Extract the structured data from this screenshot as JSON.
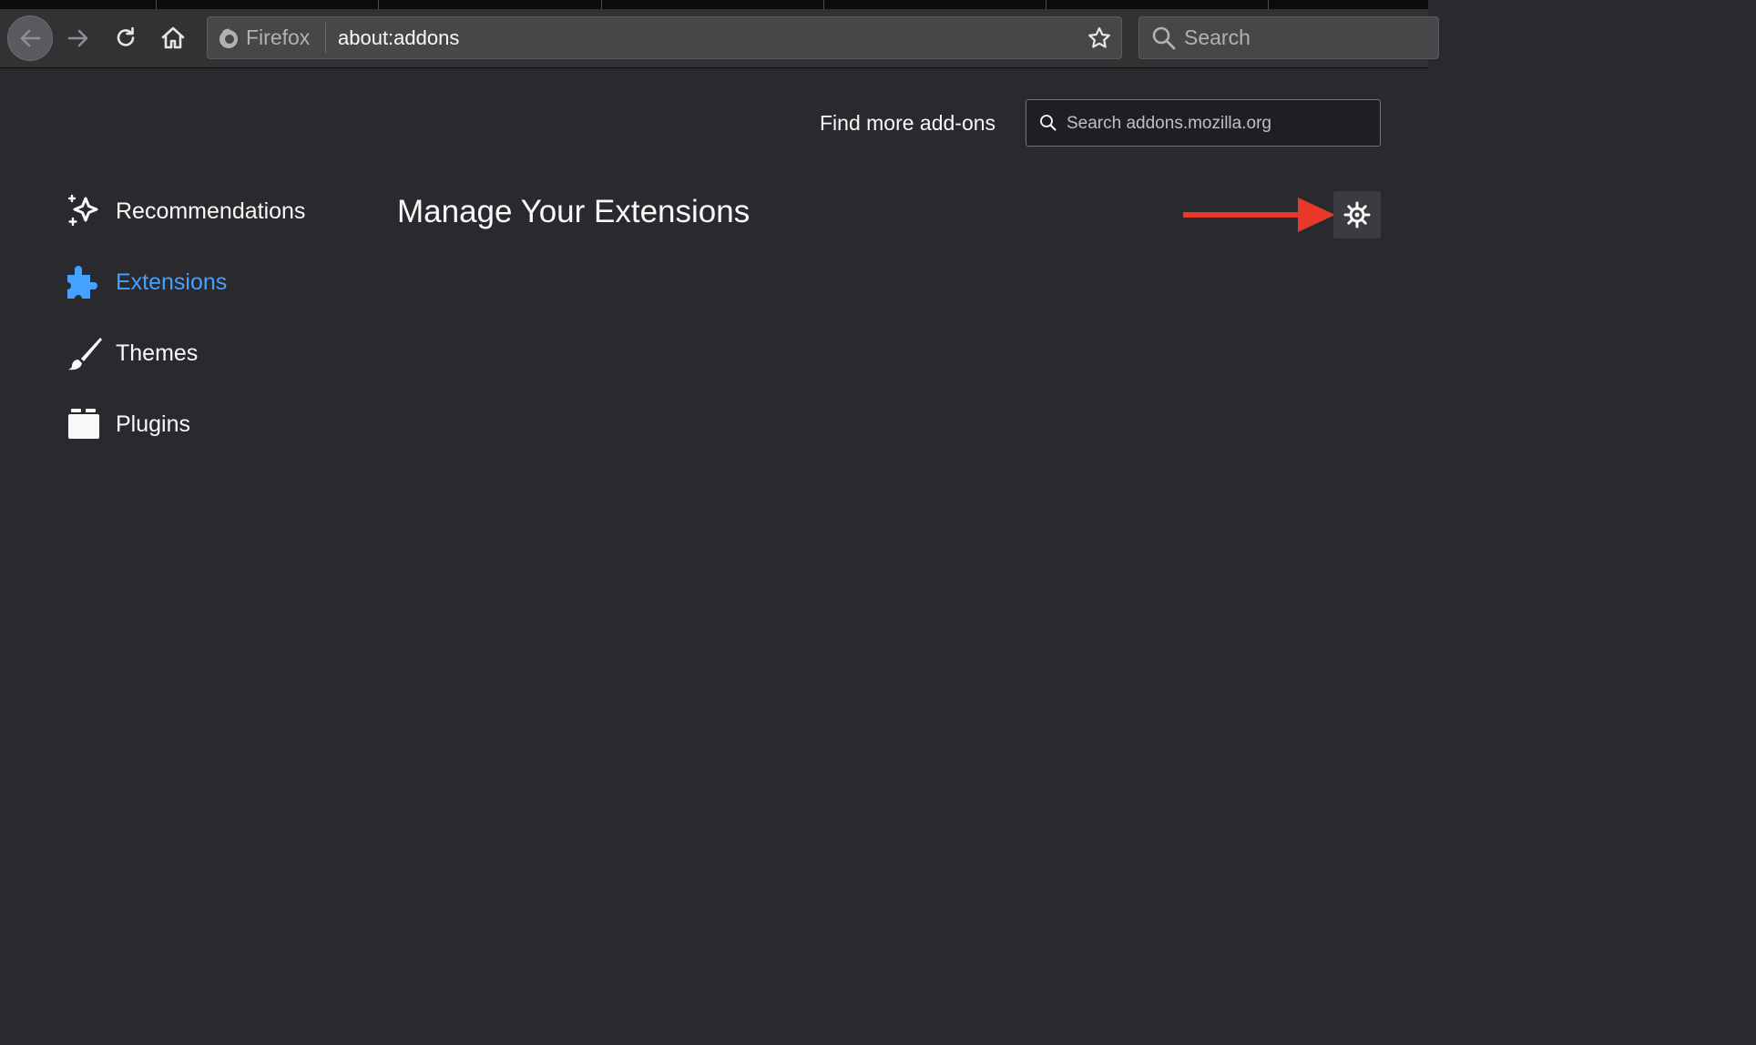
{
  "browser": {
    "identity_label": "Firefox",
    "url": "about:addons",
    "search_placeholder": "Search"
  },
  "header": {
    "find_more_label": "Find more add-ons",
    "amo_search_placeholder": "Search addons.mozilla.org"
  },
  "sidebar": {
    "items": [
      {
        "label": "Recommendations",
        "icon": "sparkle-icon",
        "selected": false
      },
      {
        "label": "Extensions",
        "icon": "puzzle-piece-icon",
        "selected": true
      },
      {
        "label": "Themes",
        "icon": "paintbrush-icon",
        "selected": false
      },
      {
        "label": "Plugins",
        "icon": "plugin-block-icon",
        "selected": false
      }
    ]
  },
  "main": {
    "title": "Manage Your Extensions"
  },
  "colors": {
    "background": "#2a2a2e",
    "toolbar": "#323234",
    "accent": "#45a1ff",
    "annotation_arrow": "#e8382a"
  }
}
